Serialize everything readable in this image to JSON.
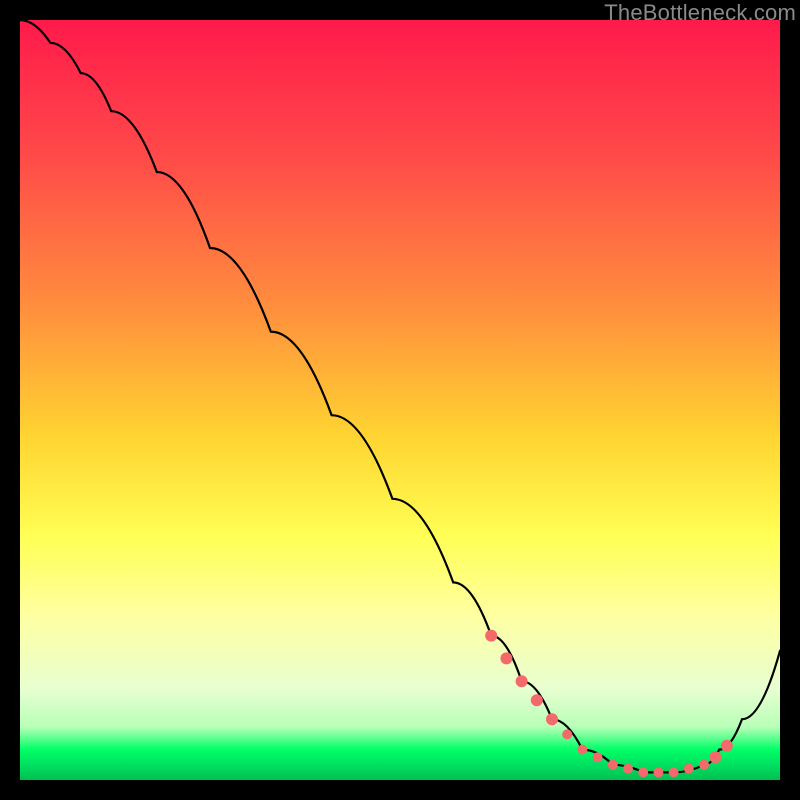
{
  "credit": "TheBottleneck.com",
  "colors": {
    "marker": "#f46a6a",
    "curve": "#000000",
    "gradient_top": "#ff1a4b",
    "gradient_bottom": "#00c050",
    "background": "#000000"
  },
  "chart_data": {
    "type": "line",
    "title": "",
    "xlabel": "",
    "ylabel": "",
    "xlim": [
      0,
      100
    ],
    "ylim": [
      0,
      100
    ],
    "series": [
      {
        "name": "curve",
        "x": [
          0,
          4,
          8,
          12,
          18,
          25,
          33,
          41,
          49,
          57,
          62,
          66,
          70,
          74,
          78,
          82,
          86,
          90,
          92,
          95,
          100
        ],
        "y": [
          100,
          97,
          93,
          88,
          80,
          70,
          59,
          48,
          37,
          26,
          19,
          13,
          8,
          4,
          2,
          1,
          1,
          2,
          4,
          8,
          17
        ]
      }
    ],
    "markers": {
      "name": "highlight-points",
      "x": [
        62,
        64,
        66,
        68,
        70,
        72,
        74,
        76,
        78,
        80,
        82,
        84,
        86,
        88,
        90,
        91.5,
        93
      ],
      "y": [
        19,
        16,
        13,
        10.5,
        8,
        6,
        4,
        3,
        2,
        1.5,
        1,
        1,
        1,
        1.5,
        2,
        3,
        4.5
      ],
      "r": [
        6,
        6,
        6,
        6,
        6,
        5,
        5,
        5,
        5,
        5,
        5,
        5,
        5,
        5,
        5,
        6,
        6
      ]
    }
  }
}
